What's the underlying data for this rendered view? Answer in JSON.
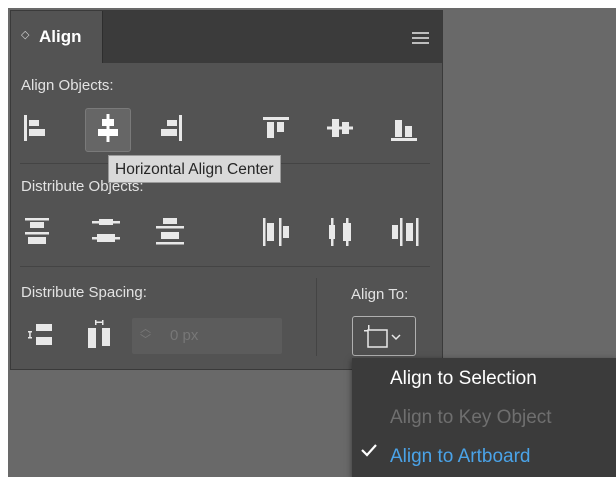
{
  "panel": {
    "tab_label": "Align",
    "tab_chevron": "◇"
  },
  "sections": {
    "align_objects": "Align Objects:",
    "distribute_objects": "Distribute Objects:",
    "distribute_spacing": "Distribute Spacing:",
    "align_to": "Align To:"
  },
  "tooltip": "Horizontal Align Center",
  "spacing_field": {
    "value": "0 px"
  },
  "align_to_menu": {
    "items": [
      {
        "label": "Align to Selection",
        "state": "enabled"
      },
      {
        "label": "Align to Key Object",
        "state": "disabled"
      },
      {
        "label": "Align to Artboard",
        "state": "checked"
      }
    ]
  },
  "icons": [
    "horizontal-align-left-icon",
    "horizontal-align-center-icon",
    "horizontal-align-right-icon",
    "vertical-align-top-icon",
    "vertical-align-center-icon",
    "vertical-align-bottom-icon",
    "vertical-distribute-top-icon",
    "vertical-distribute-center-icon",
    "vertical-distribute-bottom-icon",
    "horizontal-distribute-left-icon",
    "horizontal-distribute-center-icon",
    "horizontal-distribute-right-icon",
    "vertical-distribute-space-icon",
    "horizontal-distribute-space-icon",
    "align-to-artboard-icon",
    "hamburger-menu-icon",
    "checkmark-icon"
  ],
  "colors": {
    "panel_bg": "#535353",
    "header_bg": "#3b3b3b",
    "icon": "#e8e8e8",
    "menu_enabled": "#ffffff",
    "menu_disabled": "#6f6f6f",
    "menu_checked": "#4aa3e8"
  }
}
